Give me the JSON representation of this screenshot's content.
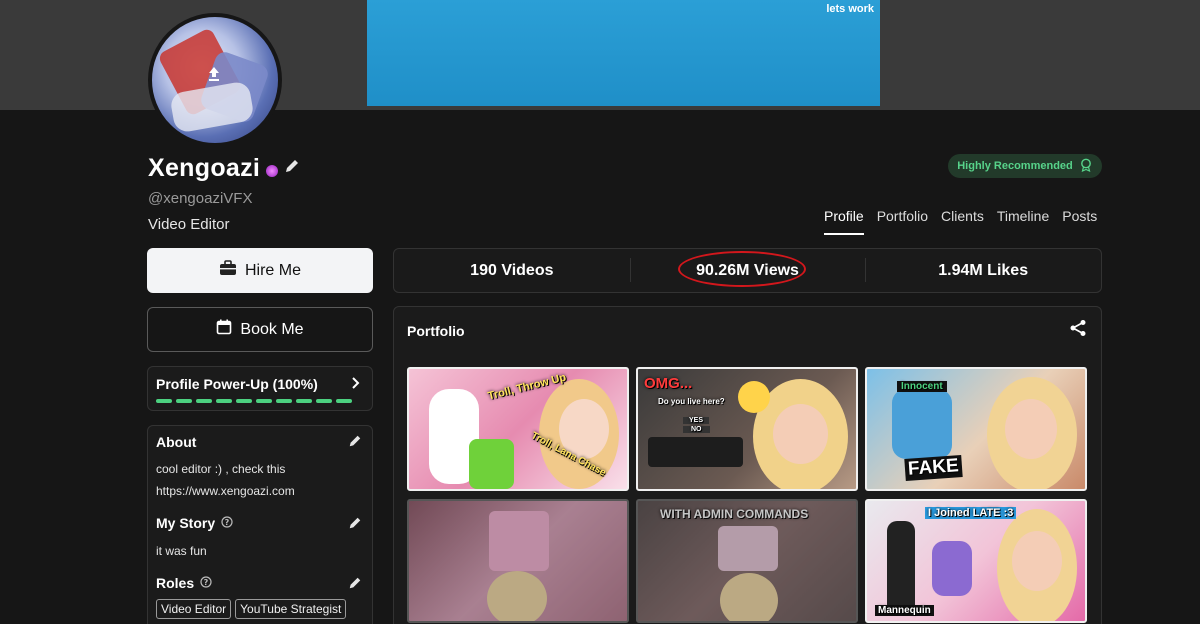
{
  "banner": {
    "text": "lets work"
  },
  "profile": {
    "name": "Xengoazi",
    "handle": "@xengoaziVFX",
    "role_title": "Video Editor",
    "badge": "Highly Recommended"
  },
  "tabs": [
    "Profile",
    "Portfolio",
    "Clients",
    "Timeline",
    "Posts"
  ],
  "actions": {
    "hire": "Hire Me",
    "book": "Book Me"
  },
  "stats": {
    "videos": "190 Videos",
    "views": "90.26M Views",
    "likes": "1.94M Likes"
  },
  "powerup": {
    "title": "Profile Power-Up (100%)",
    "progress": 1.0
  },
  "about": {
    "title": "About",
    "line1": "cool editor :) , check this",
    "line2": "https://www.xengoazi.com"
  },
  "story": {
    "title": "My Story",
    "text": "it was fun"
  },
  "roles": {
    "title": "Roles",
    "chips": [
      "Video Editor",
      "YouTube Strategist"
    ]
  },
  "portfolio": {
    "title": "Portfolio",
    "thumbnails": [
      {
        "caption_a": "Troll, Throw Up",
        "caption_b": "Troll, Lana Chase"
      },
      {
        "caption_a": "OMG...",
        "caption_b": "Do you live here?",
        "caption_c": "YES",
        "caption_d": "NO"
      },
      {
        "caption_a": "Innocent",
        "caption_b": "FAKE"
      },
      {
        "caption_a": ""
      },
      {
        "caption_a": "WITH ADMIN COMMANDS"
      },
      {
        "caption_a": "I Joined LATE :3",
        "caption_b": "Mannequin"
      }
    ]
  },
  "colors": {
    "accent_green": "#4cd180",
    "banner_blue": "#2b9fd6",
    "highlight_red": "#d3171c"
  }
}
